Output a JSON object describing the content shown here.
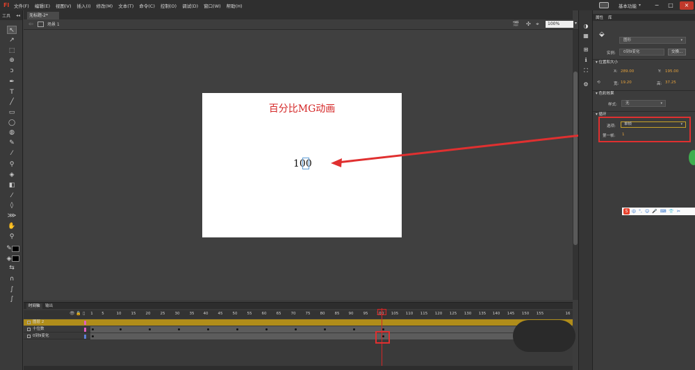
{
  "app": {
    "logo": "Fl",
    "menus": [
      "文件(F)",
      "编辑(E)",
      "视图(V)",
      "插入(I)",
      "修改(M)",
      "文本(T)",
      "命令(C)",
      "控制(O)",
      "调试(D)",
      "窗口(W)",
      "帮助(H)"
    ],
    "workspace": "基本功能",
    "window_buttons": [
      "−",
      "□",
      "×"
    ]
  },
  "tools_panel": {
    "label": "工具"
  },
  "document": {
    "tab": "无标题-2*",
    "scene": "场景 1",
    "zoom": "100%"
  },
  "stage": {
    "title": "百分比MG动画",
    "counter": "100"
  },
  "timeline": {
    "tabs": [
      "时间轴",
      "输出"
    ],
    "ruler": [
      "1",
      "5",
      "10",
      "15",
      "20",
      "25",
      "30",
      "35",
      "40",
      "45",
      "50",
      "55",
      "60",
      "65",
      "70",
      "75",
      "80",
      "85",
      "90",
      "95",
      "100",
      "105",
      "110",
      "115",
      "120",
      "125",
      "130",
      "135",
      "140",
      "145",
      "150",
      "155",
      "16"
    ],
    "layers": [
      {
        "name": "图层 2",
        "color": "#e25fc0"
      },
      {
        "name": "十位数",
        "color": "#e25fc0"
      },
      {
        "name": "0到9变化",
        "color": "#5b7fd5"
      }
    ]
  },
  "properties": {
    "tabs": [
      "属性",
      "库"
    ],
    "instance_type": "图形",
    "instance_label": "实例:",
    "instance_name": "0到9变化",
    "swap_button": "交换...",
    "position_section": "位置和大小",
    "x_label": "X:",
    "x_value": "289.00",
    "y_label": "Y:",
    "y_value": "195.00",
    "w_label": "宽:",
    "w_value": "19.20",
    "h_label": "高:",
    "h_value": "37.25",
    "color_section": "色彩效果",
    "style_label": "样式:",
    "style_value": "无",
    "loop_section": "循环",
    "options_label": "选项:",
    "options_value": "单帧",
    "first_frame_label": "第一帧:",
    "first_frame_value": "1"
  },
  "ime": {
    "logo": "S",
    "items": [
      "中",
      "°,",
      "☺",
      "🎤",
      "⌨",
      "👕",
      "✂"
    ]
  },
  "colors": {
    "accent_red": "#d42525",
    "selected_layer": "#b08d1a",
    "value_orange": "#e6a23c"
  }
}
